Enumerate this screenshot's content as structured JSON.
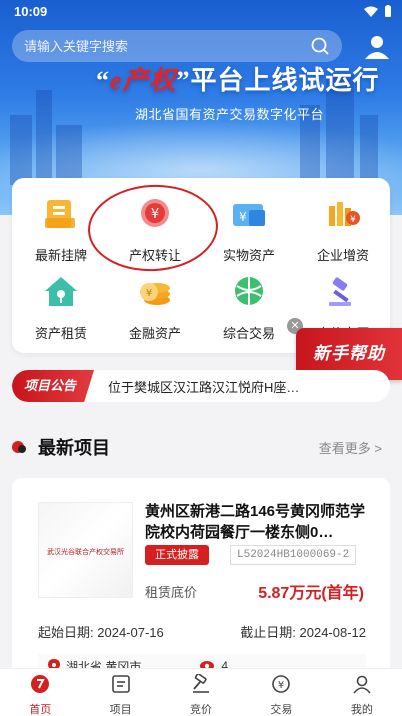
{
  "status": {
    "time": "10:09"
  },
  "search": {
    "placeholder": "请输入关键字搜索"
  },
  "banner": {
    "title_prefix": "“",
    "title_brand": "e产权",
    "title_suffix": "”平台上线试运行",
    "subtitle": "湖北省国有资产交易数字化平台"
  },
  "categories": [
    {
      "label": "最新挂牌",
      "icon": "new-listing-icon"
    },
    {
      "label": "产权转让",
      "icon": "property-transfer-icon"
    },
    {
      "label": "实物资产",
      "icon": "physical-asset-icon"
    },
    {
      "label": "企业增资",
      "icon": "capital-increase-icon"
    },
    {
      "label": "资产租赁",
      "icon": "asset-lease-icon"
    },
    {
      "label": "金融资产",
      "icon": "financial-asset-icon"
    },
    {
      "label": "综合交易",
      "icon": "comprehensive-trade-icon"
    },
    {
      "label": "竞价大厅",
      "icon": "auction-hall-icon"
    }
  ],
  "help": {
    "label": "新手帮助"
  },
  "announcement": {
    "tag": "项目公告",
    "text": "位于樊城区汉江路汉江悦府H座…"
  },
  "latest": {
    "title": "最新项目",
    "more": "查看更多 >"
  },
  "project": {
    "thumb_text": "武汉光谷联合产权交易所",
    "title": "黄州区新港二路146号黄冈师范学院校内荷园餐厅一楼东侧0…",
    "status": "正式披露",
    "code": "L52024HB1000069-2",
    "price_label": "租赁底价",
    "price": "5.87万元(首年)",
    "start_label": "起始日期:",
    "start_date": "2024-07-16",
    "end_label": "截止日期:",
    "end_date": "2024-08-12",
    "location": "湖北省 黄冈市",
    "views": "4"
  },
  "tabs": [
    {
      "label": "首页",
      "active": true
    },
    {
      "label": "项目"
    },
    {
      "label": "竞价"
    },
    {
      "label": "交易"
    },
    {
      "label": "我的"
    }
  ],
  "colors": {
    "accent": "#d42020",
    "banner": "#2f7de6"
  }
}
